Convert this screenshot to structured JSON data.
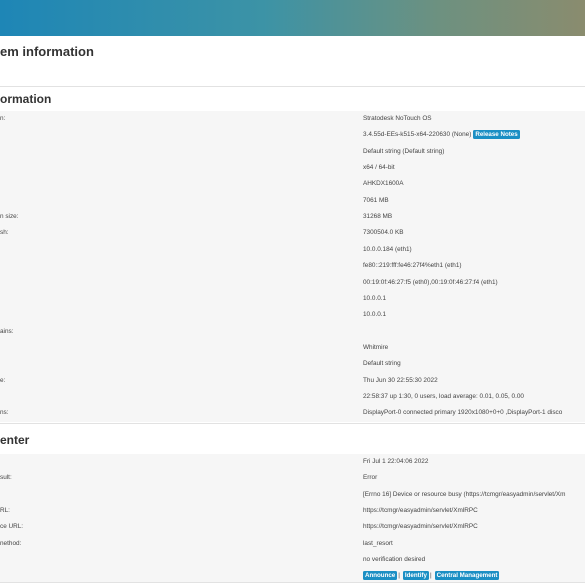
{
  "page_title": "em information",
  "system_info": {
    "title": "ormation",
    "rows": [
      {
        "label": "n:",
        "value": "Stratodesk NoTouch OS"
      },
      {
        "label": "",
        "value": "3.4.55d-EEs-k515-x64-220630 (None)",
        "button": "Release Notes"
      },
      {
        "label": "",
        "value": "Default string (Default string)"
      },
      {
        "label": "",
        "value": "x64 / 64-bit"
      },
      {
        "label": "",
        "value": "AHKDX1600A"
      },
      {
        "label": "",
        "value": "7061 MB"
      },
      {
        "label": "n size:",
        "value": "31268 MB"
      },
      {
        "label": "sh:",
        "value": "7300504.0 KB"
      },
      {
        "label": "",
        "value": "10.0.0.184 (eth1)"
      },
      {
        "label": "",
        "value": "fe80::219:fff:fe46:27f4%eth1 (eth1)"
      },
      {
        "label": "",
        "value": "00:19:0f:46:27:f5 (eth0),00:19:0f:46:27:f4 (eth1)"
      },
      {
        "label": "",
        "value": "10.0.0.1"
      },
      {
        "label": "",
        "value": "10.0.0.1"
      },
      {
        "label": "ains:",
        "value": ""
      },
      {
        "label": "",
        "value": "Whitmire"
      },
      {
        "label": "",
        "value": "Default string"
      },
      {
        "label": "e:",
        "value": "Thu Jun 30 22:55:30 2022"
      },
      {
        "label": "",
        "value": "22:58:37 up 1:30, 0 users, load average: 0.01, 0.05, 0.00"
      },
      {
        "label": "ns:",
        "value": "DisplayPort-0 connected primary 1920x1080+0+0 ,DisplayPort-1 disco"
      }
    ]
  },
  "center": {
    "title": "enter",
    "rows": [
      {
        "label": "",
        "value": "Fri Jul 1 22:04:06 2022"
      },
      {
        "label": "sult:",
        "value": "Error"
      },
      {
        "label": "",
        "value": "[Errno 16] Device or resource busy (https://tcmgr/easyadmin/servlet/Xm"
      },
      {
        "label": "RL:",
        "value": "https://tcmgr/easyadmin/servlet/XmlRPC"
      },
      {
        "label": "ce URL:",
        "value": "https://tcmgr/easyadmin/servlet/XmlRPC"
      },
      {
        "label": "nethod:",
        "value": "last_resort"
      },
      {
        "label": "",
        "value": "no verification desired"
      }
    ],
    "actions": {
      "announce": "Announce",
      "identify": "Identify",
      "central": "Central Management",
      "separator": "|"
    }
  }
}
